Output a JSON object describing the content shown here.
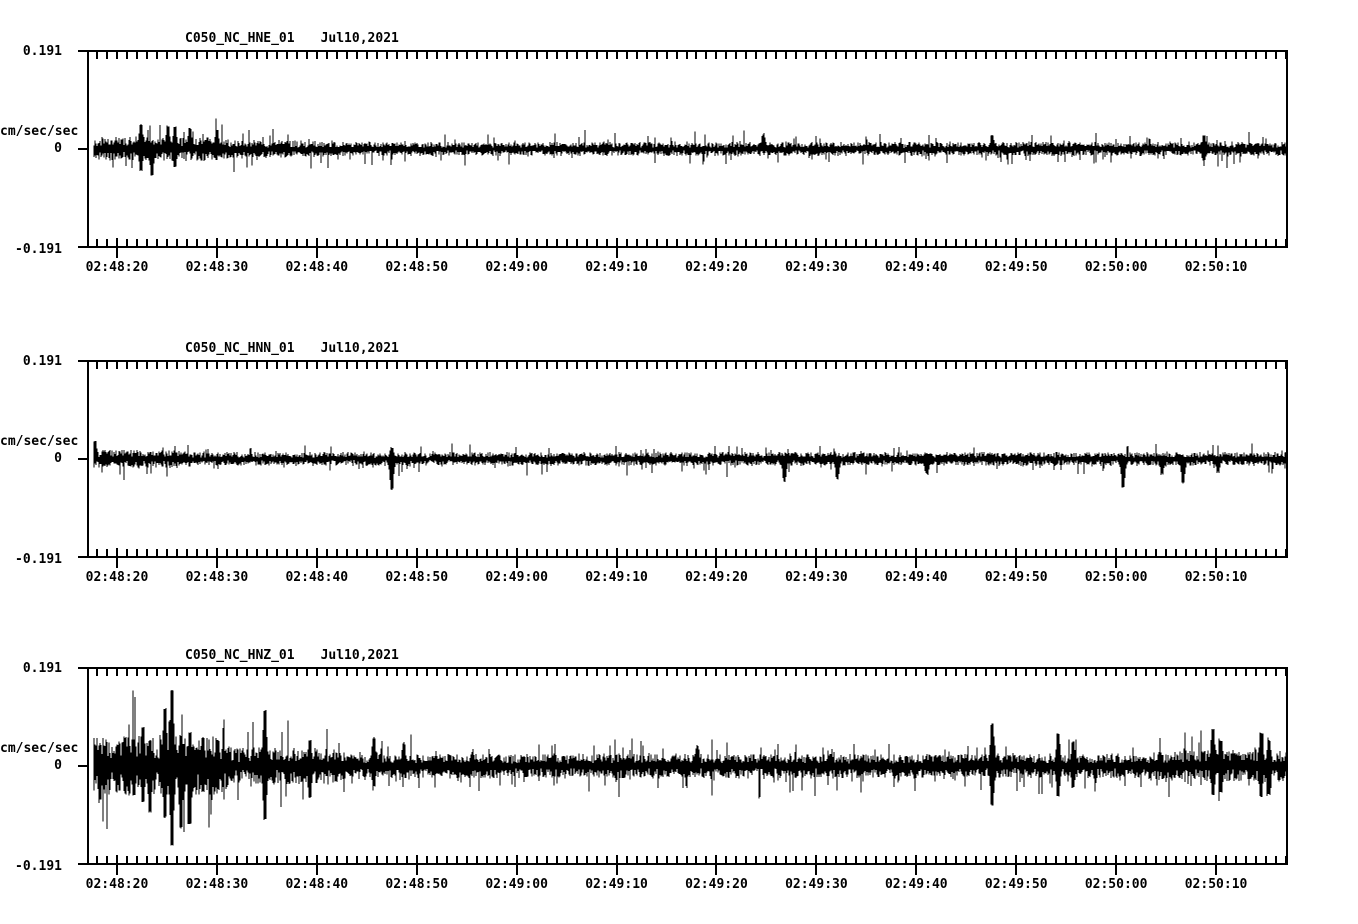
{
  "figure": {
    "background": "#ffffff",
    "ink": "#000000",
    "kind": "three-component strong-motion seismogram"
  },
  "x_axis": {
    "major_tick_labels": [
      "02:48:20",
      "02:48:30",
      "02:48:40",
      "02:48:50",
      "02:49:00",
      "02:49:10",
      "02:49:20",
      "02:49:30",
      "02:49:40",
      "02:49:50",
      "02:50:00",
      "02:50:10"
    ],
    "first_major_offset_sec": 2.9,
    "major_interval_sec": 10,
    "minor_interval_sec": 1,
    "duration_sec": 120
  },
  "chart_data": [
    {
      "type": "line",
      "title": "C050_NC_HNE_01",
      "date": "Jul10,2021",
      "xlabel": "",
      "ylabel": "cm/sec/sec",
      "ylim": [
        -0.191,
        0.191
      ],
      "ytick_labels": [
        "0.191",
        "0",
        "-0.191"
      ],
      "seed": 101,
      "noise_amp": 0.0105,
      "tail": 0.09,
      "envelope": [
        {
          "t0": 1.5,
          "t1": 13,
          "mult": 1.8
        },
        {
          "t0": 13,
          "t1": 22,
          "mult": 1.25
        }
      ],
      "spikes": [
        {
          "t": 5.3,
          "up": 0.048,
          "down": 0.042
        },
        {
          "t": 6.4,
          "down": 0.052
        },
        {
          "t": 8.0,
          "up": 0.045
        },
        {
          "t": 8.7,
          "up": 0.042,
          "down": 0.036
        },
        {
          "t": 10.2,
          "up": 0.04
        },
        {
          "t": 12.9,
          "up": 0.036
        },
        {
          "t": 67.6,
          "up": 0.03
        },
        {
          "t": 90.5,
          "up": 0.026
        },
        {
          "t": 111.7,
          "up": 0.026,
          "down": 0.022
        }
      ]
    },
    {
      "type": "line",
      "title": "C050_NC_HNN_01",
      "date": "Jul10,2021",
      "xlabel": "",
      "ylabel": "cm/sec/sec",
      "ylim": [
        -0.191,
        0.191
      ],
      "ytick_labels": [
        "0.191",
        "0",
        "-0.191"
      ],
      "seed": 202,
      "noise_amp": 0.0105,
      "tail": 0.08,
      "envelope": [
        {
          "t0": 0,
          "t1": 8,
          "mult": 1.3
        }
      ],
      "spikes": [
        {
          "t": 0.7,
          "up": 0.034
        },
        {
          "t": 30.4,
          "up": 0.022,
          "down": 0.06
        },
        {
          "t": 69.7,
          "down": 0.044
        },
        {
          "t": 75.0,
          "down": 0.04
        },
        {
          "t": 84.0,
          "down": 0.03
        },
        {
          "t": 103.6,
          "down": 0.056
        },
        {
          "t": 107.5,
          "down": 0.03
        },
        {
          "t": 109.6,
          "down": 0.046
        },
        {
          "t": 113.1,
          "down": 0.026
        }
      ]
    },
    {
      "type": "line",
      "title": "C050_NC_HNZ_01",
      "date": "Jul10,2021",
      "xlabel": "",
      "ylabel": "cm/sec/sec",
      "ylim": [
        -0.191,
        0.191
      ],
      "ytick_labels": [
        "0.191",
        "0",
        "-0.191"
      ],
      "seed": 303,
      "noise_amp": 0.019,
      "tail": 0.12,
      "envelope": [
        {
          "t0": 0,
          "t1": 13,
          "mult": 2.4
        },
        {
          "t0": 13,
          "t1": 24,
          "mult": 1.5
        },
        {
          "t0": 108,
          "t1": 120,
          "mult": 1.3
        }
      ],
      "spikes": [
        {
          "t": 1.2,
          "up": 0.04,
          "down": 0.066
        },
        {
          "t": 3.7,
          "up": 0.056,
          "down": 0.05
        },
        {
          "t": 4.6,
          "up": 0.05,
          "down": 0.058
        },
        {
          "t": 5.5,
          "up": 0.075,
          "down": 0.07
        },
        {
          "t": 6.2,
          "up": 0.05,
          "down": 0.09
        },
        {
          "t": 7.7,
          "up": 0.112,
          "down": 0.1
        },
        {
          "t": 8.4,
          "up": 0.147,
          "down": 0.155
        },
        {
          "t": 9.3,
          "up": 0.06,
          "down": 0.12
        },
        {
          "t": 10.2,
          "up": 0.065,
          "down": 0.113
        },
        {
          "t": 11.5,
          "up": 0.055,
          "down": 0.05
        },
        {
          "t": 13.0,
          "up": 0.05,
          "down": 0.045
        },
        {
          "t": 17.7,
          "up": 0.108,
          "down": 0.104
        },
        {
          "t": 22.2,
          "up": 0.05,
          "down": 0.062
        },
        {
          "t": 28.6,
          "up": 0.055,
          "down": 0.04
        },
        {
          "t": 31.6,
          "up": 0.045
        },
        {
          "t": 61.0,
          "up": 0.04
        },
        {
          "t": 90.5,
          "up": 0.082,
          "down": 0.078
        },
        {
          "t": 97.1,
          "up": 0.063,
          "down": 0.059
        },
        {
          "t": 98.6,
          "up": 0.047,
          "down": 0.042
        },
        {
          "t": 112.6,
          "up": 0.071,
          "down": 0.057
        },
        {
          "t": 113.4,
          "up": 0.05,
          "down": 0.05
        },
        {
          "t": 117.4,
          "up": 0.064,
          "down": 0.06
        },
        {
          "t": 118.2,
          "up": 0.05,
          "down": 0.055
        }
      ]
    }
  ]
}
